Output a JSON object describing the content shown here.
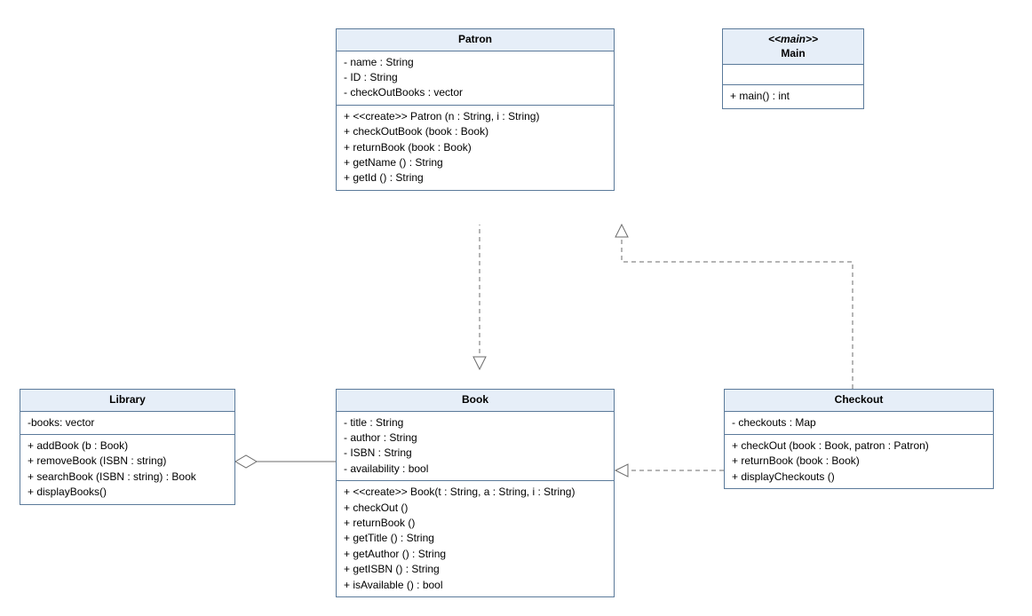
{
  "classes": {
    "patron": {
      "name": "Patron",
      "attrs": [
        "- name : String",
        "- ID : String",
        "- checkOutBooks : vector"
      ],
      "ops": [
        "+ <<create>> Patron (n : String, i : String)",
        "+ checkOutBook (book : Book)",
        "+ returnBook (book : Book)",
        "+ getName () : String",
        "+ getId () : String"
      ]
    },
    "main": {
      "stereotype": "<<main>>",
      "name": "Main",
      "attrs": [],
      "ops": [
        "+ main() : int"
      ]
    },
    "library": {
      "name": "Library",
      "attrs": [
        "-books: vector"
      ],
      "ops": [
        "+ addBook (b : Book)",
        "+ removeBook (ISBN : string)",
        "+ searchBook (ISBN : string) : Book",
        "+ displayBooks()"
      ]
    },
    "book": {
      "name": "Book",
      "attrs": [
        "- title : String",
        "- author : String",
        "- ISBN : String",
        "- availability : bool"
      ],
      "ops": [
        "+ <<create>> Book(t : String, a : String, i : String)",
        "+ checkOut ()",
        "+ returnBook ()",
        "+ getTitle () : String",
        "+ getAuthor () : String",
        "+ getISBN () : String",
        "+ isAvailable () : bool"
      ]
    },
    "checkout": {
      "name": "Checkout",
      "attrs": [
        "- checkouts : Map"
      ],
      "ops": [
        "+ checkOut (book : Book, patron : Patron)",
        "+ returnBook (book : Book)",
        "+ displayCheckouts ()"
      ]
    }
  },
  "relations": [
    {
      "type": "realization",
      "from": "Patron",
      "to": "Book"
    },
    {
      "type": "realization",
      "from": "Checkout",
      "to": "Patron"
    },
    {
      "type": "realization",
      "from": "Checkout",
      "to": "Book"
    },
    {
      "type": "aggregation",
      "from": "Library",
      "to": "Book"
    }
  ]
}
